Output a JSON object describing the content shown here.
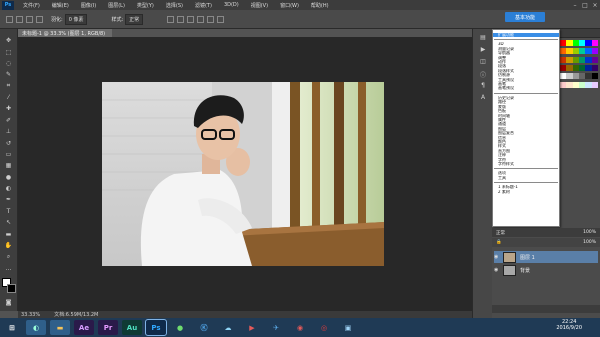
{
  "menubar": {
    "app_icon": "Ps",
    "items": [
      "文件(F)",
      "编辑(E)",
      "图像(I)",
      "图层(L)",
      "类型(Y)",
      "选择(S)",
      "滤镜(T)",
      "3D(D)",
      "视图(V)",
      "窗口(W)",
      "帮助(H)"
    ]
  },
  "options": {
    "tool_label": "羽化:",
    "feather_value": "0 像素",
    "style_label": "样式:",
    "style_value": "正常",
    "workspace_button": "基本功能"
  },
  "document": {
    "tab_title": "未标题-1 @ 33.3% (图层 1, RGB/8)",
    "zoom": "33.33%",
    "doc_info": "文档:6.59M/13.2M"
  },
  "window_menu": {
    "group1": [
      "3D",
      "测量记录",
      "导航器",
      "调整",
      "动作",
      "段落",
      "段落样式",
      "仿制源",
      "工具预设",
      "画笔",
      "画笔预设"
    ],
    "group2": [
      "历史记录",
      "路径",
      "蒙版",
      "色板",
      "时间轴",
      "属性",
      "通道",
      "图层",
      "图层复合",
      "信息",
      "颜色",
      "样式",
      "直方图",
      "注释",
      "字符",
      "字符样式"
    ],
    "group3": [
      "选项",
      "工具"
    ],
    "group4": [
      "1 未标题-1",
      "2 素材"
    ],
    "highlighted": "扩展功能"
  },
  "layers": {
    "blend_mode": "正常",
    "opacity": "100%",
    "fill": "100%",
    "items": [
      {
        "name": "图层 1",
        "selected": true
      },
      {
        "name": "背景",
        "selected": false
      }
    ]
  },
  "taskbar": {
    "apps": [
      {
        "label": "Ae",
        "color": "#2a1a4a",
        "fg": "#d79eff"
      },
      {
        "label": "Pr",
        "color": "#2a1a4a",
        "fg": "#e59aff"
      },
      {
        "label": "Au",
        "color": "#0f3a34",
        "fg": "#4fe0c2"
      },
      {
        "label": "Ps",
        "color": "#0f2a4a",
        "fg": "#31a8ff"
      }
    ],
    "time": "22:24",
    "date": "2016/9/20"
  }
}
